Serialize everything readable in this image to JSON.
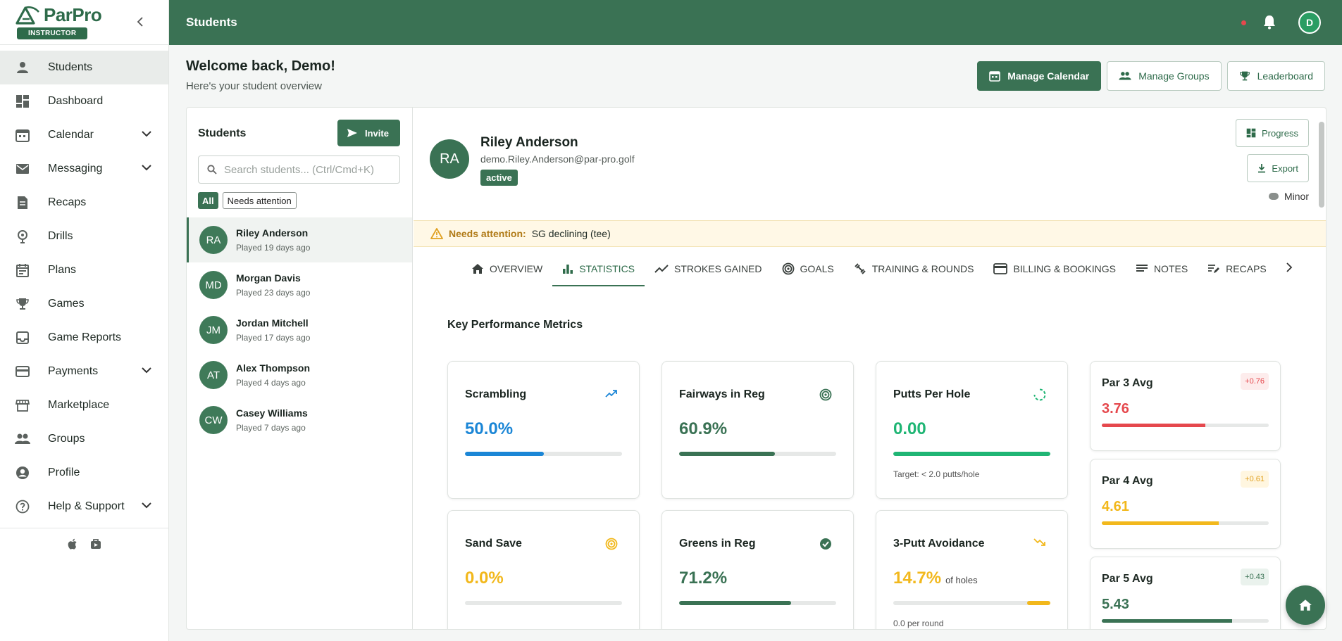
{
  "app": {
    "name": "ParPro",
    "role": "INSTRUCTOR",
    "page_title": "Students",
    "user_initial": "D"
  },
  "sidebar": {
    "items": [
      {
        "label": "Students",
        "icon": "person-icon",
        "active": true
      },
      {
        "label": "Dashboard",
        "icon": "dashboard-icon"
      },
      {
        "label": "Calendar",
        "icon": "calendar-icon",
        "expandable": true
      },
      {
        "label": "Messaging",
        "icon": "mail-icon",
        "expandable": true
      },
      {
        "label": "Recaps",
        "icon": "recap-icon"
      },
      {
        "label": "Drills",
        "icon": "drill-icon"
      },
      {
        "label": "Plans",
        "icon": "plan-icon"
      },
      {
        "label": "Games",
        "icon": "trophy-icon"
      },
      {
        "label": "Game Reports",
        "icon": "inbox-icon"
      },
      {
        "label": "Payments",
        "icon": "card-icon",
        "expandable": true
      },
      {
        "label": "Marketplace",
        "icon": "store-icon"
      },
      {
        "label": "Groups",
        "icon": "groups-icon"
      },
      {
        "label": "Profile",
        "icon": "account-icon"
      },
      {
        "label": "Help & Support",
        "icon": "help-icon",
        "expandable": true
      }
    ]
  },
  "welcome": {
    "heading": "Welcome back, Demo!",
    "subheading": "Here's your student overview"
  },
  "actions": {
    "manage_calendar": "Manage Calendar",
    "manage_groups": "Manage Groups",
    "leaderboard": "Leaderboard"
  },
  "students_panel": {
    "title": "Students",
    "invite_label": "Invite",
    "search_placeholder": "Search students... (Ctrl/Cmd+K)",
    "filters": [
      "All",
      "Needs attention"
    ],
    "students": [
      {
        "initials": "RA",
        "name": "Riley Anderson",
        "sub": "Played 19 days ago"
      },
      {
        "initials": "MD",
        "name": "Morgan Davis",
        "sub": "Played 23 days ago"
      },
      {
        "initials": "JM",
        "name": "Jordan Mitchell",
        "sub": "Played 17 days ago"
      },
      {
        "initials": "AT",
        "name": "Alex Thompson",
        "sub": "Played 4 days ago"
      },
      {
        "initials": "CW",
        "name": "Casey Williams",
        "sub": "Played 7 days ago"
      }
    ]
  },
  "profile": {
    "initials": "RA",
    "name": "Riley Anderson",
    "email": "demo.Riley.Anderson@par-pro.golf",
    "status": "active",
    "progress_label": "Progress",
    "export_label": "Export",
    "minor_label": "Minor"
  },
  "alert": {
    "label": "Needs attention:",
    "text": "SG declining (tee)"
  },
  "tabs": [
    {
      "label": "OVERVIEW"
    },
    {
      "label": "STATISTICS",
      "active": true
    },
    {
      "label": "STROKES GAINED"
    },
    {
      "label": "GOALS"
    },
    {
      "label": "TRAINING & ROUNDS"
    },
    {
      "label": "BILLING & BOOKINGS"
    },
    {
      "label": "NOTES"
    },
    {
      "label": "RECAPS"
    }
  ],
  "metrics": {
    "title": "Key Performance Metrics",
    "cards": [
      {
        "title": "Scrambling",
        "value": "50.0%",
        "fill_pct": 50,
        "color": "#1b86d6"
      },
      {
        "title": "Fairways in Reg",
        "value": "60.9%",
        "fill_pct": 60.9,
        "color": "#3a7254"
      },
      {
        "title": "Putts Per Hole",
        "value": "0.00",
        "fill_pct": 100,
        "color": "#1fb574",
        "note": "Target: < 2.0 putts/hole"
      },
      {
        "title": "Sand Save",
        "value": "0.0%",
        "fill_pct": 0,
        "color": "#f2b81c"
      },
      {
        "title": "Greens in Reg",
        "value": "71.2%",
        "fill_pct": 71.2,
        "color": "#3a7254"
      },
      {
        "title": "3-Putt Avoidance",
        "value": "14.7%",
        "unit": "of holes",
        "fill_pct": 14.7,
        "color": "#f2b81c",
        "note": "0.0 per round"
      }
    ],
    "par": [
      {
        "title": "Par 3 Avg",
        "value": "3.76",
        "delta": "+0.76",
        "color": "#e5484d",
        "fill_pct": 62
      },
      {
        "title": "Par 4 Avg",
        "value": "4.61",
        "delta": "+0.61",
        "color": "#f2b81c",
        "fill_pct": 70
      },
      {
        "title": "Par 5 Avg",
        "value": "5.43",
        "delta": "+0.43",
        "color": "#3a7254",
        "fill_pct": 78
      }
    ]
  }
}
